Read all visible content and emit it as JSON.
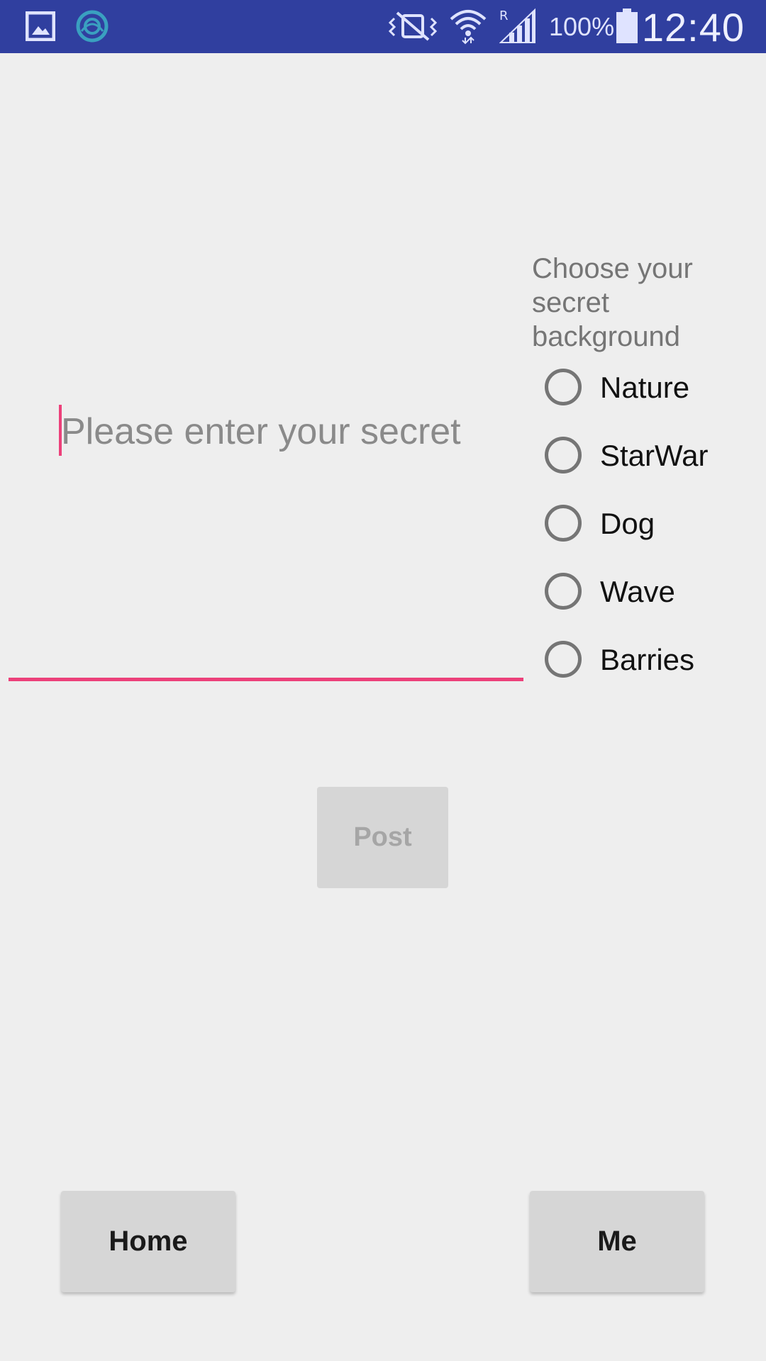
{
  "status_bar": {
    "background_color": "#303f9f",
    "icons": [
      "gallery-icon",
      "app-notification-icon",
      "vibrate-mute-icon",
      "wifi-icon",
      "signal-icon",
      "battery-icon"
    ],
    "battery_percent": "100%",
    "time": "12:40"
  },
  "secret_input": {
    "placeholder": "Please enter your secret",
    "value": "",
    "accent_color": "#ec407a"
  },
  "background_chooser": {
    "title": "Choose your secret background",
    "options": [
      {
        "label": "Nature",
        "selected": false
      },
      {
        "label": "StarWar",
        "selected": false
      },
      {
        "label": "Dog",
        "selected": false
      },
      {
        "label": "Wave",
        "selected": false
      },
      {
        "label": "Barries",
        "selected": false
      }
    ]
  },
  "post_button": {
    "label": "Post",
    "enabled": false
  },
  "bottom_nav": {
    "home_label": "Home",
    "me_label": "Me"
  }
}
